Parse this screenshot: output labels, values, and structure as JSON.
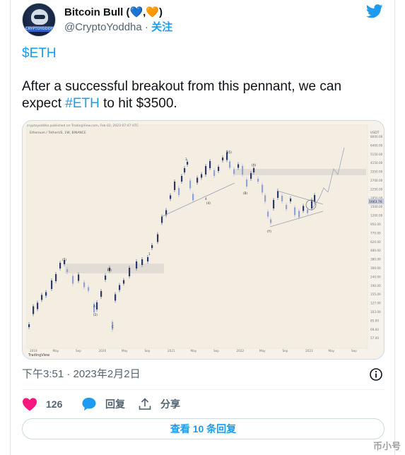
{
  "author": {
    "name": "Bitcoin Bull (💙,🧡)",
    "handle": "@CryptoYoddha",
    "separator": "·",
    "follow_label": "关注",
    "avatar_label": "CRYPTOYODDHA"
  },
  "tweet": {
    "cashtag_line": "$ETH",
    "text_before": "After a successful breakout from this pennant, we can expect ",
    "hashtag": "#ETH",
    "text_after": " to hit $3500.",
    "timestamp": "下午3:51 · 2023年2月2日"
  },
  "actions": {
    "likes_count": "126",
    "reply_label": "回复",
    "share_label": "分享",
    "view_replies_label": "查看 10 条回复"
  },
  "chart_image": {
    "header": "cryptoyoddha published on TradingView.com, Feb 02, 2023 07:47 UTC",
    "pair": "Ethereum / TetherUS, 1W, BINANCE",
    "currency": "USDT",
    "price_label": "1663.76",
    "x_ticks": [
      "2019",
      "May",
      "Sep",
      "2020",
      "May",
      "Sep",
      "2021",
      "May",
      "Sep",
      "2022",
      "May",
      "Sep",
      "2023",
      "May",
      "Sep"
    ],
    "y_ticks": [
      "8000.00",
      "6400.00",
      "5150.00",
      "4150.00",
      "3350.00",
      "2700.00",
      "2250.00",
      "1850.00",
      "1500.00",
      "1200.00",
      "950.00",
      "770.00",
      "620.00",
      "480.00",
      "380.00",
      "300.00",
      "240.00",
      "190.00",
      "155.00",
      "127.00",
      "103.00",
      "85.00",
      "69.00",
      "57.00"
    ],
    "wave_labels": [
      "(1)",
      "(2)",
      "1",
      "2",
      "3",
      "4",
      "5",
      "(3)",
      "(4)",
      "(5)",
      "(A)",
      "(B)",
      "(Y)",
      "A",
      "B",
      "C"
    ],
    "logo": "TradingView"
  },
  "colors": {
    "accent": "#1d9bf0",
    "like": "#f91880",
    "text_secondary": "#536471"
  },
  "watermark": "币小号"
}
